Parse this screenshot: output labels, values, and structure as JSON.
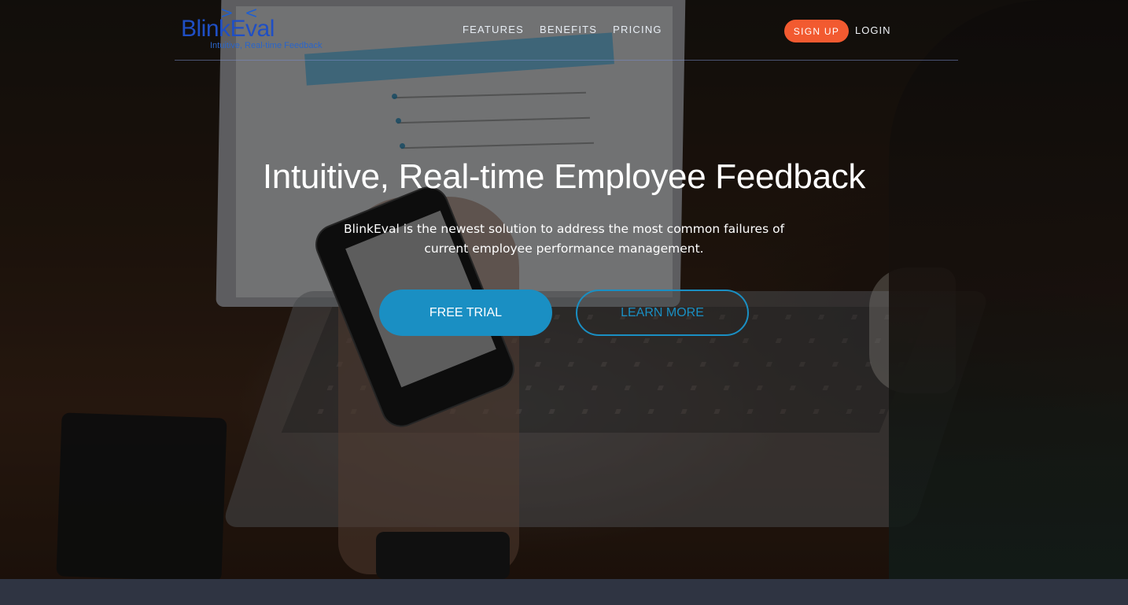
{
  "brand": {
    "logo_eyes": "> <",
    "name": "BlinkEval",
    "tagline": "Intuitive, Real-time Feedback"
  },
  "nav": {
    "links": [
      {
        "label": "FEATURES"
      },
      {
        "label": "BENEFITS"
      },
      {
        "label": "PRICING"
      }
    ],
    "signup_label": "SIGN UP",
    "login_label": "LOGIN"
  },
  "hero": {
    "headline": "Intuitive, Real-time Employee Feedback",
    "subheadline": "BlinkEval is the newest solution to address the most common failures of current employee performance management.",
    "primary_cta": "FREE TRIAL",
    "secondary_cta": "LEARN MORE"
  },
  "colors": {
    "accent": "#1a8fc3",
    "signup": "#f25a30",
    "logo": "#1f4fc4",
    "footer_band": "#2f3442"
  }
}
